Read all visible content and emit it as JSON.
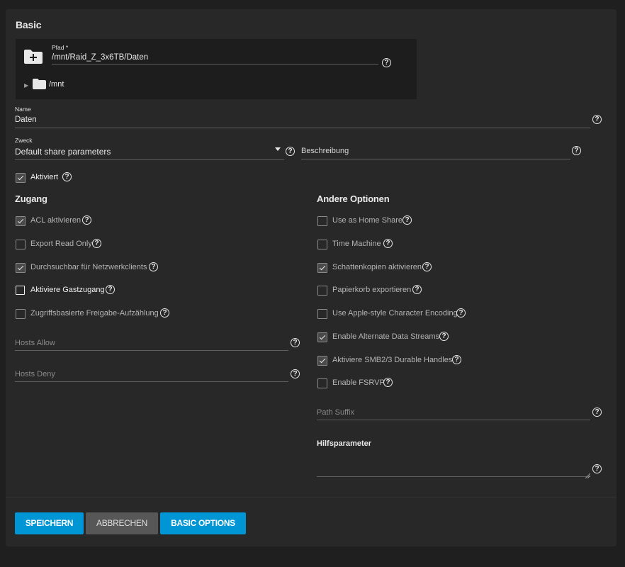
{
  "basic": {
    "title": "Basic",
    "path_label": "Pfad *",
    "path_value": "/mnt/Raid_Z_3x6TB/Daten",
    "tree_root": "/mnt",
    "name_label": "Name",
    "name_value": "Daten",
    "purpose_label": "Zweck",
    "purpose_value": "Default share parameters",
    "description_placeholder": "Beschreibung",
    "enabled_label": "Aktiviert"
  },
  "access": {
    "title": "Zugang",
    "options": [
      {
        "label": "ACL aktivieren",
        "checked": true
      },
      {
        "label": "Export Read Only",
        "checked": false
      },
      {
        "label": "Durchsuchbar für Netzwerkclients",
        "checked": true
      },
      {
        "label": "Aktiviere Gastzugang",
        "checked": false
      },
      {
        "label": "Zugriffsbasierte Freigabe-Aufzählung",
        "checked": false
      }
    ],
    "hosts_allow_placeholder": "Hosts Allow",
    "hosts_deny_placeholder": "Hosts Deny"
  },
  "other": {
    "title": "Andere Optionen",
    "options": [
      {
        "label": "Use as Home Share",
        "checked": false
      },
      {
        "label": "Time Machine",
        "checked": false
      },
      {
        "label": "Schattenkopien aktivieren",
        "checked": true
      },
      {
        "label": "Papierkorb exportieren",
        "checked": false
      },
      {
        "label": "Use Apple-style Character Encoding",
        "checked": false
      },
      {
        "label": "Enable Alternate Data Streams",
        "checked": true
      },
      {
        "label": "Aktiviere SMB2/3 Durable Handles",
        "checked": true
      },
      {
        "label": "Enable FSRVP",
        "checked": false
      }
    ],
    "path_suffix_placeholder": "Path Suffix",
    "aux_params_label": "Hilfsparameter"
  },
  "buttons": {
    "save": "SPEICHERN",
    "cancel": "ABBRECHEN",
    "basic_options": "BASIC OPTIONS"
  },
  "icons": {
    "help": "question-circle-icon",
    "folder_add": "folder-plus-icon",
    "folder": "folder-icon",
    "tree_expand": "triangle-right-icon",
    "dropdown": "caret-down-icon",
    "check": "check-icon"
  },
  "colors": {
    "primary": "#0095d5",
    "secondary_button": "#575757",
    "card_background": "#282828",
    "page_background": "#1f1f1f"
  }
}
